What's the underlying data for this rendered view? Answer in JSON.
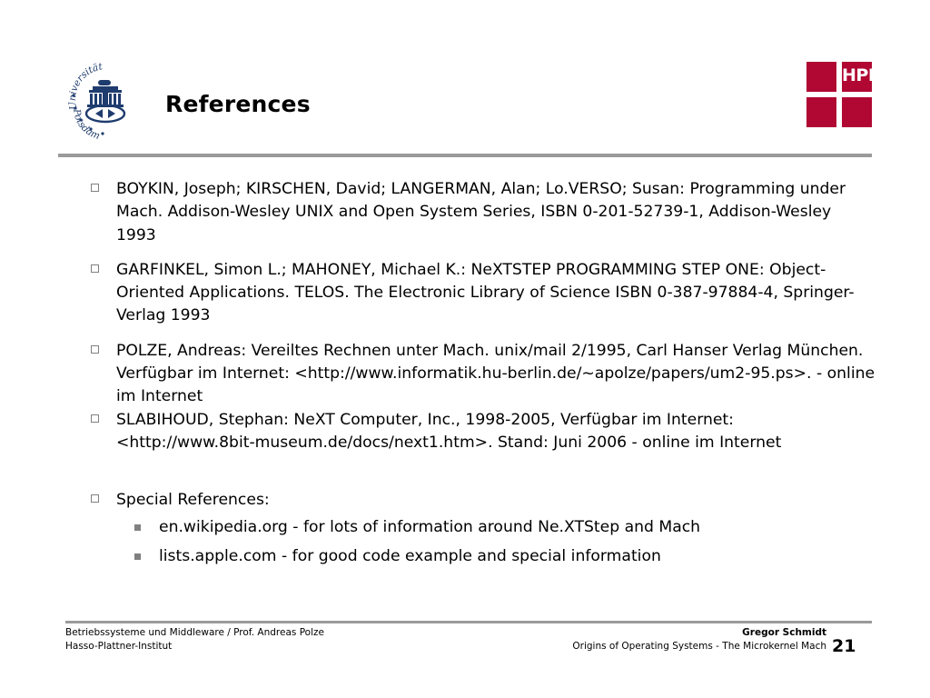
{
  "slide": {
    "title": "References",
    "page_number": "21"
  },
  "logos": {
    "potsdam": {
      "name": "university-of-potsdam-seal",
      "text_top": "Universität",
      "text_bottom": "Potsdam",
      "color": "#1f3c6e"
    },
    "hpi": {
      "name": "hpi-logo",
      "wordmark": "HPI",
      "color": "#b00733"
    }
  },
  "theme": {
    "rule_color": "#9a9a9a",
    "bullet_color": "#808080",
    "text_color": "#000000",
    "background": "#ffffff"
  },
  "references": [
    {
      "id": "boykin",
      "text": "BOYKIN, Joseph; KIRSCHEN, David; LANGERMAN, Alan; Lo.VERSO; Susan: Programming under Mach. Addison-Wesley UNIX and Open System Series, ISBN 0-201-52739-1, Addison-Wesley 1993"
    },
    {
      "id": "garfinkel",
      "text": "GARFINKEL, Simon L.; MAHONEY, Michael K.: NeXTSTEP PROGRAMMING STEP ONE: Object-Oriented Applications. TELOS. The Electronic Library of Science ISBN 0-387-97884-4, Springer-Verlag 1993"
    },
    {
      "id": "polze",
      "text": "POLZE, Andreas: Vereiltes Rechnen unter Mach. unix/mail 2/1995, Carl Hanser Verlag München. Verfügbar im Internet: <http://www.informatik.hu-berlin.de/~apolze/papers/um2-95.ps>. - online im Internet"
    },
    {
      "id": "slabihoud",
      "text": "SLABIHOUD, Stephan: NeXT Computer, Inc., 1998-2005, Verfügbar im Internet: <http://www.8bit-museum.de/docs/next1.htm>. Stand: Juni 2006 - online im Internet"
    }
  ],
  "special_references": {
    "heading": "Special References:",
    "items": [
      {
        "id": "wikipedia",
        "text": "en.wikipedia.org - for lots of information around Ne.XTStep and Mach"
      },
      {
        "id": "apple-lists",
        "text": "lists.apple.com - for good code example and special information"
      }
    ]
  },
  "footer": {
    "line1": "Betriebssysteme und Middleware / Prof. Andreas Polze",
    "line2": "Hasso-Plattner-Institut",
    "presenter": "Gregor Schmidt",
    "subject": "Origins of Operating Systems - The Microkernel Mach"
  }
}
